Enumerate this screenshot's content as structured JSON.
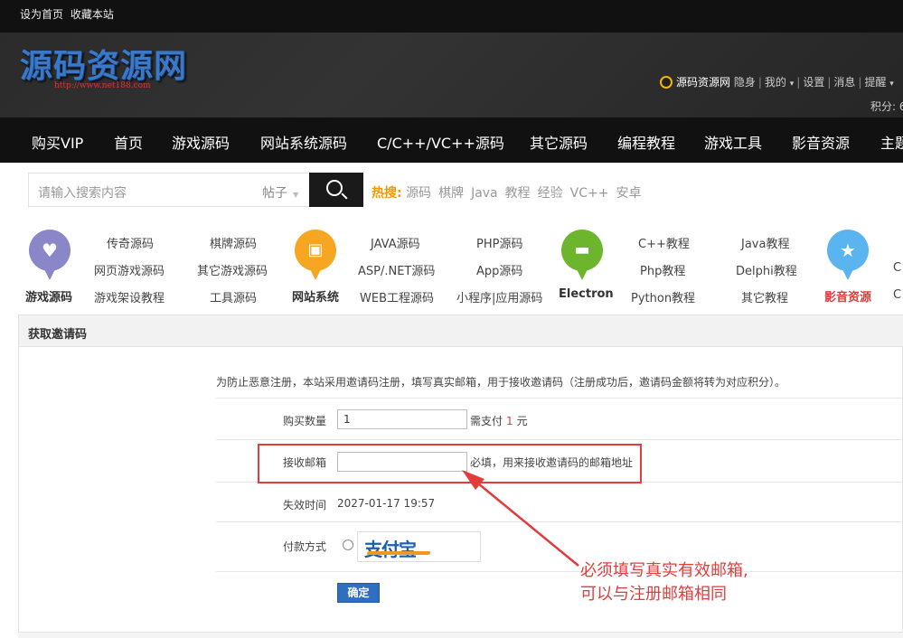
{
  "topbar": {
    "set_home": "设为首页",
    "bookmark": "收藏本站"
  },
  "header": {
    "logo_text": "源码资源网",
    "logo_url": "http://www.net188.com",
    "user": {
      "site_name": "源码资源网",
      "invisible": "隐身",
      "mine": "我的",
      "settings": "设置",
      "messages": "消息",
      "reminders": "提醒",
      "points": "积分: 6"
    }
  },
  "nav": {
    "items": [
      "购买VIP",
      "首页",
      "游戏源码",
      "网站系统源码",
      "C/C++/VC++源码",
      "其它源码",
      "编程教程",
      "游戏工具",
      "影音资源",
      "主题"
    ]
  },
  "search": {
    "placeholder": "请输入搜索内容",
    "scope": "帖子",
    "hot_label": "热搜:",
    "hot_words": [
      "源码",
      "棋牌",
      "Java",
      "教程",
      "经验",
      "VC++",
      "安卓"
    ]
  },
  "categories": [
    {
      "title": "游戏源码",
      "color": "#8a86c8",
      "icon": "heart-icon",
      "links": [
        "传奇源码",
        "棋牌源码",
        "网页游戏源码",
        "其它游戏源码",
        "游戏架设教程",
        "工具源码"
      ]
    },
    {
      "title": "网站系统",
      "color": "#f6a623",
      "icon": "contacts-icon",
      "links": [
        "JAVA源码",
        "PHP源码",
        "ASP/.NET源码",
        "App源码",
        "WEB工程源码",
        "小程序|应用源码"
      ]
    },
    {
      "title": "Electron",
      "color": "#6cb52d",
      "icon": "chat-bubble-icon",
      "links": [
        "C++教程",
        "Java教程",
        "Php教程",
        "Delphi教程",
        "Python教程",
        "其它教程"
      ]
    },
    {
      "title": "影音资源",
      "color": "#5ab4f0",
      "icon": "star-icon",
      "title_color": "#e4393c",
      "links": [
        "C",
        "C"
      ]
    }
  ],
  "form": {
    "panel_title": "获取邀请码",
    "notice": "为防止恶意注册，本站采用邀请码注册，填写真实邮箱，用于接收邀请码（注册成功后，邀请码金额将转为对应积分）。",
    "quantity_label": "购买数量",
    "quantity_value": "1",
    "pay_prefix": "需支付",
    "pay_amount": "1",
    "pay_unit": "元",
    "email_label": "接收邮箱",
    "email_value": "",
    "email_hint": "必填，用来接收邀请码的邮箱地址",
    "expire_label": "失效时间",
    "expire_value": "2027-01-17 19:57",
    "payment_label": "付款方式",
    "alipay_logo": "支付宝",
    "submit_label": "确定"
  },
  "annotation": {
    "line1": "必须填写真实有效邮箱,",
    "line2": "可以与注册邮箱相同",
    "color": "#e23c3c"
  }
}
